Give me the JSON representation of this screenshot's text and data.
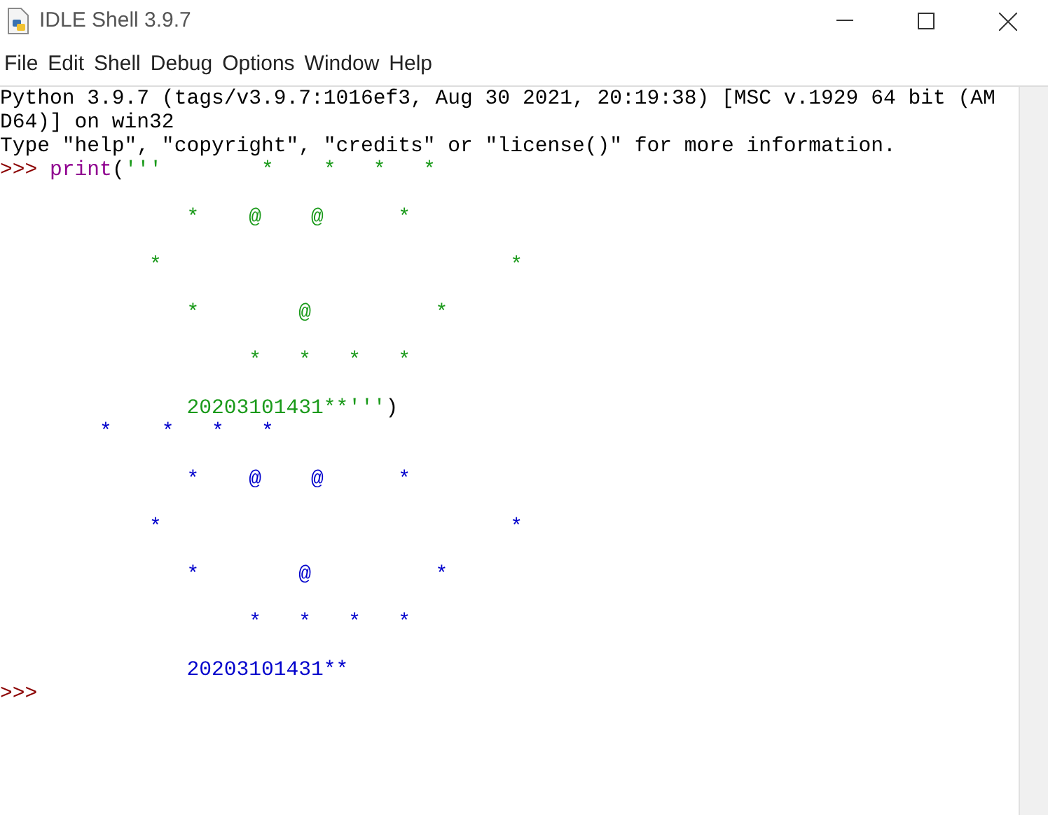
{
  "window": {
    "title": "IDLE Shell 3.9.7"
  },
  "menu": [
    "File",
    "Edit",
    "Shell",
    "Debug",
    "Options",
    "Window",
    "Help"
  ],
  "lines": [
    {
      "kind": "text",
      "segments": [
        {
          "kind": "stdout",
          "text": "Python 3.9.7 (tags/v3.9.7:1016ef3, Aug 30 2021, 20:19:38) [MSC v.1929 64 bit (AM"
        }
      ]
    },
    {
      "kind": "text",
      "segments": [
        {
          "kind": "stdout",
          "text": "D64)] on win32"
        }
      ]
    },
    {
      "kind": "text",
      "segments": [
        {
          "kind": "stdout",
          "text": "Type \"help\", \"copyright\", \"credits\" or \"license()\" for more information."
        }
      ]
    },
    {
      "kind": "text",
      "segments": [
        {
          "kind": "prompt",
          "text": ">>> "
        },
        {
          "kind": "builtin",
          "text": "print"
        },
        {
          "kind": "code",
          "text": "("
        },
        {
          "kind": "string",
          "text": "'''        *    *   *   *"
        }
      ]
    },
    {
      "kind": "blank"
    },
    {
      "kind": "text",
      "segments": [
        {
          "kind": "string",
          "text": "               *    @    @      *"
        }
      ]
    },
    {
      "kind": "blank"
    },
    {
      "kind": "text",
      "segments": [
        {
          "kind": "string",
          "text": "            *                            *"
        }
      ]
    },
    {
      "kind": "blank"
    },
    {
      "kind": "text",
      "segments": [
        {
          "kind": "string",
          "text": "               *        @          *"
        }
      ]
    },
    {
      "kind": "blank"
    },
    {
      "kind": "text",
      "segments": [
        {
          "kind": "string",
          "text": "                    *   *   *   *"
        }
      ]
    },
    {
      "kind": "blank"
    },
    {
      "kind": "text",
      "segments": [
        {
          "kind": "string",
          "text": "               20203101431**'''"
        },
        {
          "kind": "code",
          "text": ")"
        }
      ]
    },
    {
      "kind": "text",
      "segments": [
        {
          "kind": "output",
          "text": "        *    *   *   *"
        }
      ]
    },
    {
      "kind": "blank"
    },
    {
      "kind": "text",
      "segments": [
        {
          "kind": "output",
          "text": "               *    @    @      *"
        }
      ]
    },
    {
      "kind": "blank"
    },
    {
      "kind": "text",
      "segments": [
        {
          "kind": "output",
          "text": "            *                            *"
        }
      ]
    },
    {
      "kind": "blank"
    },
    {
      "kind": "text",
      "segments": [
        {
          "kind": "output",
          "text": "               *        @          *"
        }
      ]
    },
    {
      "kind": "blank"
    },
    {
      "kind": "text",
      "segments": [
        {
          "kind": "output",
          "text": "                    *   *   *   *"
        }
      ]
    },
    {
      "kind": "blank"
    },
    {
      "kind": "text",
      "segments": [
        {
          "kind": "output",
          "text": "               20203101431**"
        }
      ]
    },
    {
      "kind": "text",
      "segments": [
        {
          "kind": "prompt",
          "text": ">>>"
        }
      ]
    }
  ]
}
